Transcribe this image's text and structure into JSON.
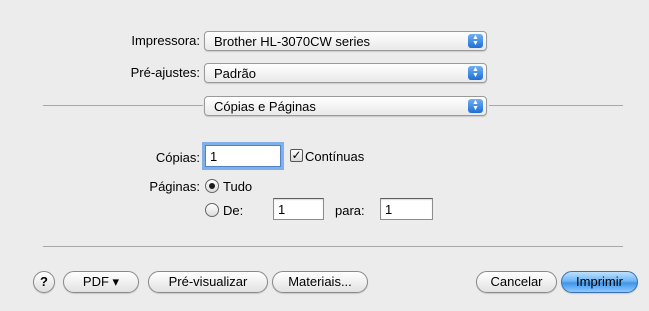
{
  "printer": {
    "label": "Impressora:",
    "value": "Brother HL-3070CW series"
  },
  "presets": {
    "label": "Pré-ajustes:",
    "value": "Padrão"
  },
  "section": {
    "value": "Cópias e Páginas"
  },
  "popup_arrows": {
    "up": "▲",
    "down": "▼"
  },
  "copies": {
    "label": "Cópias:",
    "value": "1",
    "collated_label": "Contínuas",
    "collated_checked": true,
    "check_mark": "✓"
  },
  "pages": {
    "label": "Páginas:",
    "all_label": "Tudo",
    "from_label": "De:",
    "from_value": "1",
    "to_label": "para:",
    "to_value": "1",
    "selected": "all"
  },
  "footer": {
    "help": "?",
    "pdf": "PDF ▾",
    "preview": "Pré-visualizar",
    "supplies": "Materiais...",
    "cancel": "Cancelar",
    "print": "Imprimir"
  },
  "colors": {
    "accent": "#3f95ea",
    "background": "#ececec"
  }
}
